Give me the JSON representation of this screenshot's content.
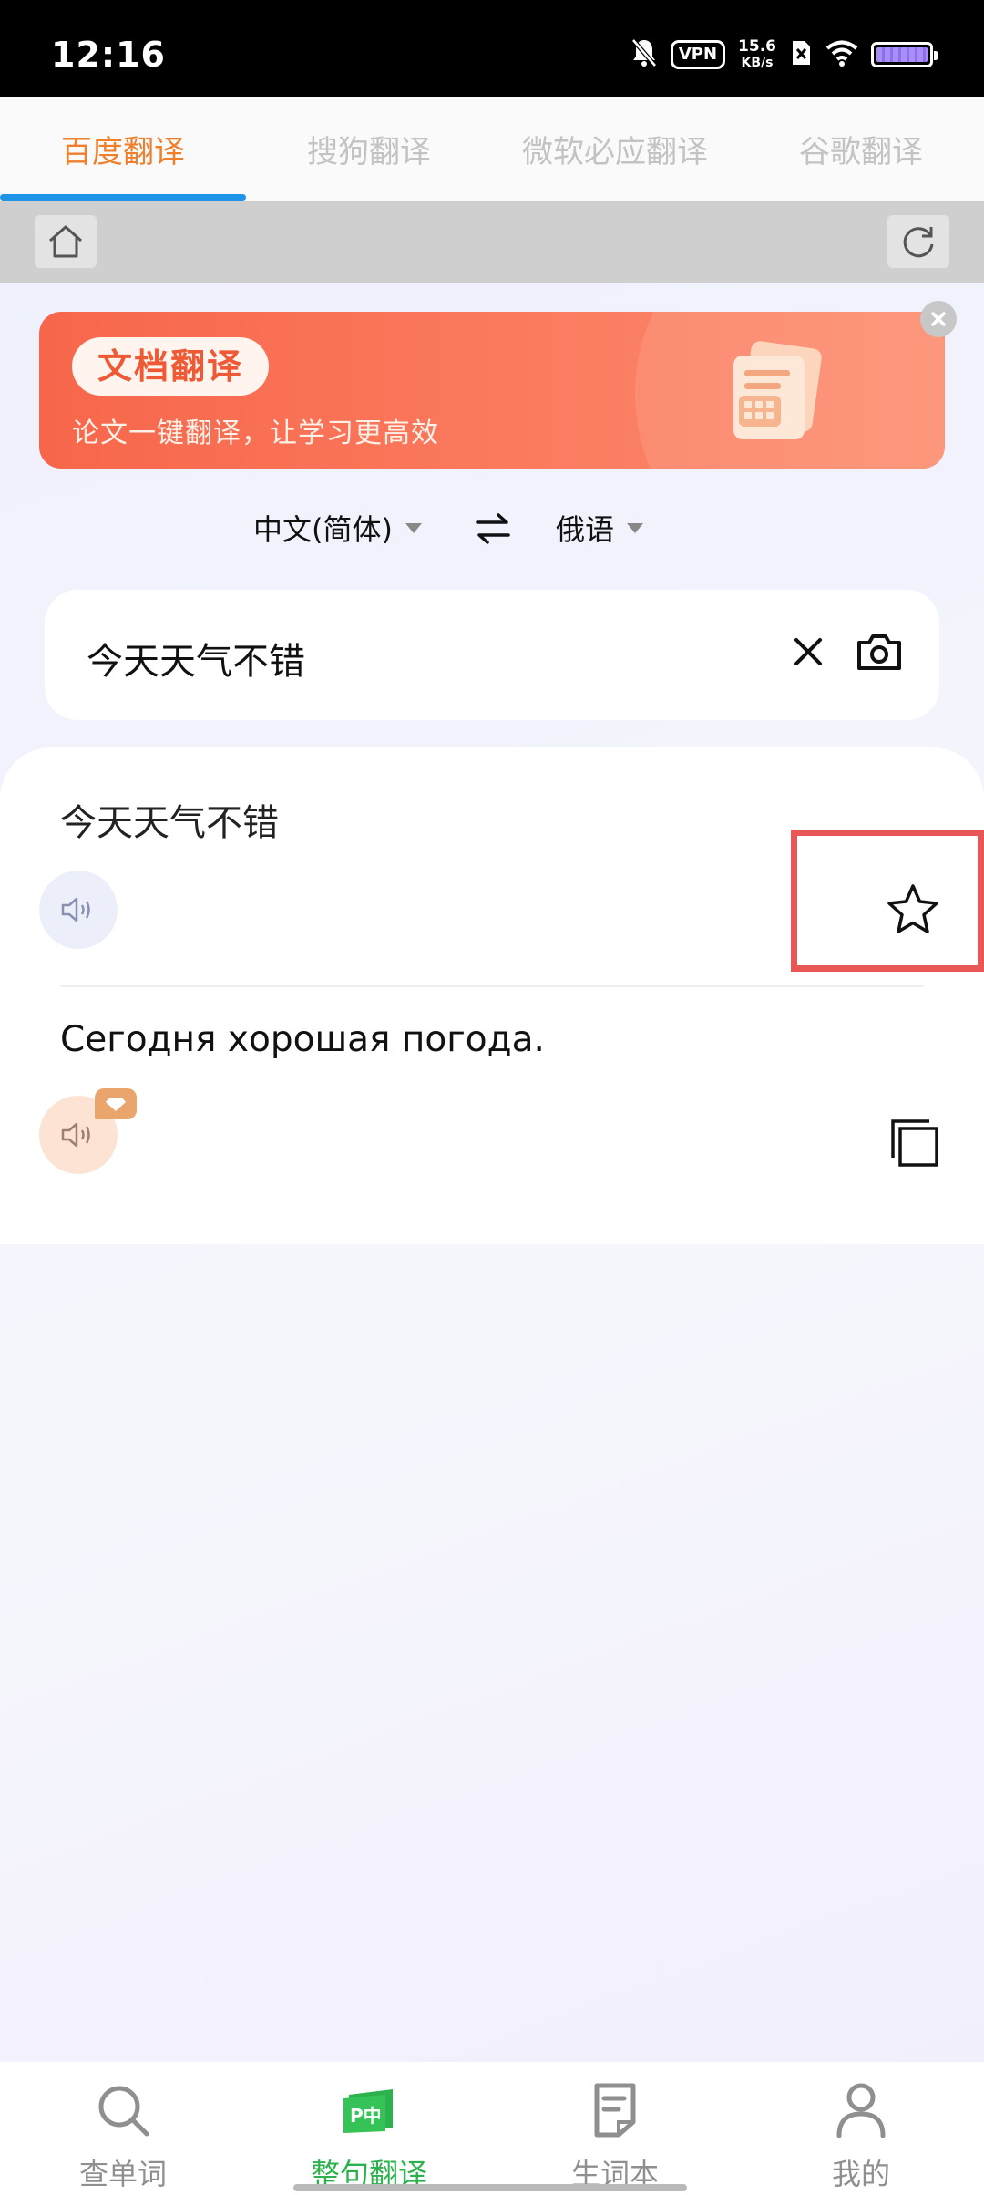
{
  "status_bar": {
    "time": "12:16",
    "vpn": "VPN",
    "net_speed_value": "15.6",
    "net_speed_unit": "KB/s"
  },
  "engine_tabs": [
    {
      "label": "百度翻译",
      "active": true
    },
    {
      "label": "搜狗翻译",
      "active": false
    },
    {
      "label": "微软必应翻译",
      "active": false
    },
    {
      "label": "谷歌翻译",
      "active": false
    }
  ],
  "promo": {
    "tag": "文档翻译",
    "subtitle": "论文一键翻译，让学习更高效"
  },
  "language": {
    "source": "中文(简体)",
    "target": "俄语"
  },
  "input": {
    "value": "今天天气不错"
  },
  "result": {
    "source_text": "今天天气不错",
    "translation": "Сегодня хорошая погода."
  },
  "bottom_nav": [
    {
      "label": "查单词",
      "icon": "search-icon",
      "active": false
    },
    {
      "label": "整句翻译",
      "icon": "sentence-translate-icon",
      "active": true
    },
    {
      "label": "生词本",
      "icon": "notebook-icon",
      "active": false
    },
    {
      "label": "我的",
      "icon": "person-icon",
      "active": false
    }
  ],
  "colors": {
    "accent_orange": "#f07f2c",
    "tab_underline": "#1d94e8",
    "nav_active_green": "#2bb24c",
    "highlight_red": "#e85656",
    "promo_orange": "#f7664b"
  }
}
